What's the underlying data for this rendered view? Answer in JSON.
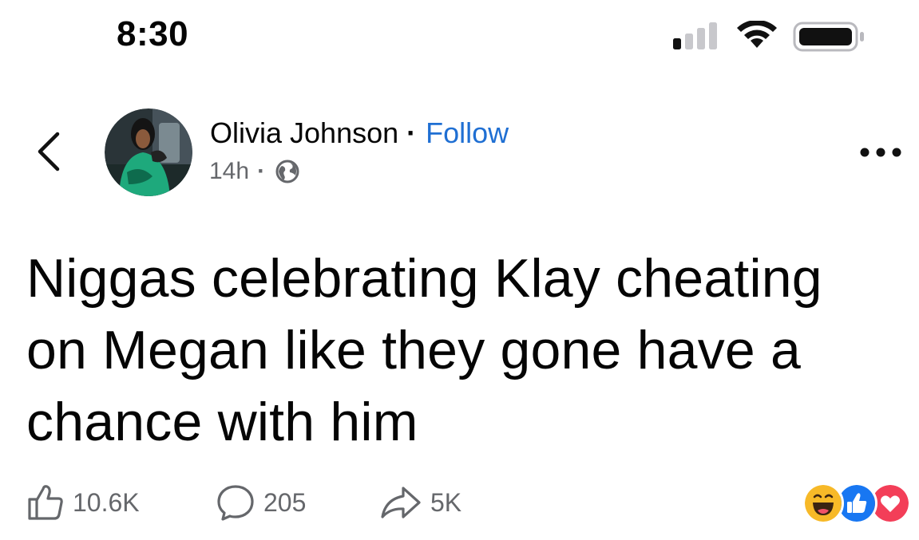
{
  "status_bar": {
    "time": "8:30",
    "icons": [
      "signal-icon",
      "wifi-icon",
      "battery-icon"
    ]
  },
  "post": {
    "author": {
      "name": "Olivia Johnson",
      "separator": "·",
      "follow_label": "Follow"
    },
    "meta": {
      "time": "14h",
      "separator": "·",
      "audience_icon": "globe-icon"
    },
    "text": "Niggas celebrating Klay cheating on Megan like they gone have a chance with him",
    "actions": {
      "likes": "10.6K",
      "comments": "205",
      "shares": "5K"
    },
    "reactions": [
      "haha-reaction-icon",
      "like-reaction-icon",
      "love-reaction-icon"
    ]
  },
  "colors": {
    "link_blue": "#1f6fd3",
    "secondary_text": "#65676b",
    "primary_text": "#050505",
    "like_blue": "#1877f2",
    "love_red": "#f33e58",
    "haha_yellow": "#f7b928"
  }
}
